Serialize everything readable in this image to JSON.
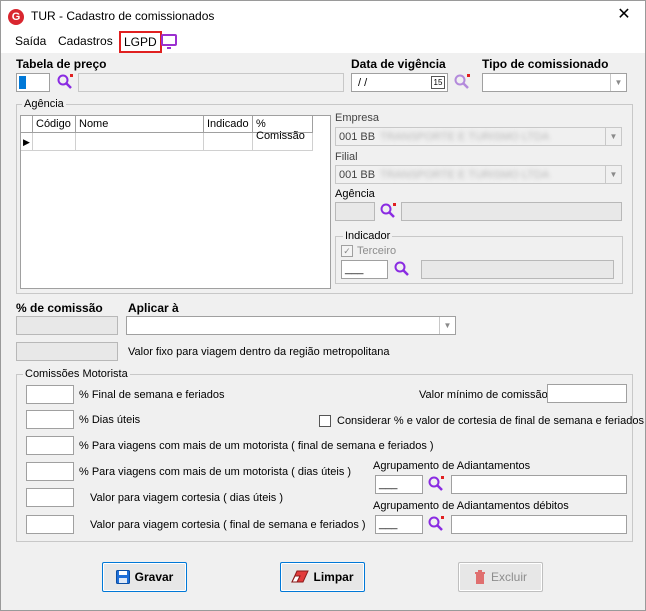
{
  "window": {
    "title": "TUR - Cadastro de comissionados",
    "app_icon_letter": "G"
  },
  "menu": {
    "items": [
      "Saída",
      "Cadastros",
      "LGPD"
    ]
  },
  "top": {
    "tabela_label": "Tabela de preço",
    "data_label": "Data de vigência",
    "data_value": " / /",
    "calendar_day": "15",
    "tipo_label": "Tipo de comissionado"
  },
  "agencia_group": {
    "title": "Agência",
    "grid_columns": [
      "Código",
      "Nome",
      "Indicado",
      "% Comissão"
    ],
    "empresa_label": "Empresa",
    "empresa_value": "001 BB",
    "empresa_blur": "TRANSPORTE E TURISMO LTDA",
    "filial_label": "Filial",
    "filial_value": "001 BB",
    "filial_blur": "TRANSPORTE E TURISMO LTDA",
    "agencia_label": "Agência",
    "indicador_title": "Indicador",
    "terceiro_label": "Terceiro",
    "indicador_value": "___"
  },
  "comissao": {
    "perc_label": "% de comissão",
    "aplicar_label": "Aplicar à",
    "valor_fixo_label": "Valor fixo para viagem dentro da região metropolitana"
  },
  "motorista": {
    "title": "Comissões Motorista",
    "rows": [
      "% Final de semana e feriados",
      "% Dias úteis",
      "% Para viagens com mais de um motorista ( final de semana e feriados )",
      "% Para viagens com mais de um motorista ( dias úteis )",
      "Valor para viagem cortesia ( dias úteis )",
      "Valor para viagem cortesia ( final de semana e feriados )"
    ],
    "valor_minimo_label": "Valor mínimo de comissão",
    "considerar_label": "Considerar % e valor de cortesia de final de semana e feriados",
    "agrup_label": "Agrupamento de Adiantamentos",
    "agrup_value": "___",
    "agrup_debitos_label": "Agrupamento de Adiantamentos débitos",
    "agrup_debitos_value": "___"
  },
  "buttons": {
    "gravar": "Gravar",
    "limpar": "Limpar",
    "excluir": "Excluir"
  },
  "colors": {
    "search_icon": "#8a2be2",
    "search_dot": "#e02020",
    "accent_border": "#0078d7"
  }
}
